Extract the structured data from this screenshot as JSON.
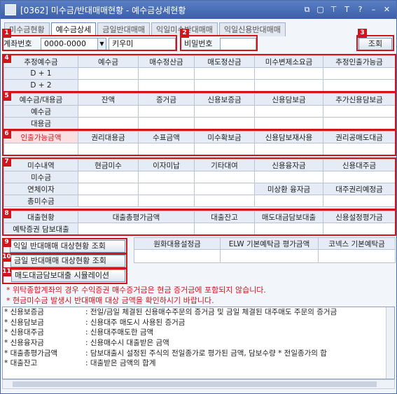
{
  "window": {
    "title": "[0362] 미수금/반대매매현황 - 예수금상세현황"
  },
  "tabs": [
    "미수금현황",
    "예수금상세",
    "금일반대매매",
    "익일미수반대매매",
    "익일신용반대매매"
  ],
  "toolbar": {
    "account_label": "계좌번호",
    "account_value": "0000-0000",
    "name_value": "키우미",
    "password_label": "비밀번호",
    "password_value": "",
    "query_button": "조회"
  },
  "badges": [
    "1",
    "2",
    "3",
    "4",
    "5",
    "6",
    "7",
    "8",
    "9",
    "10",
    "11"
  ],
  "grid4": {
    "headers": [
      "추정예수금",
      "예수금",
      "매수정산금",
      "매도정산금",
      "미수변제소요금",
      "추정인출가능금"
    ],
    "rows": [
      "D + 1",
      "D + 2"
    ]
  },
  "grid5": {
    "headers": [
      "예수금/대용금",
      "잔액",
      "증거금",
      "신용보증금",
      "신용담보금",
      "추가신용담보금"
    ],
    "rows": [
      "예수금",
      "대용금"
    ]
  },
  "grid6": {
    "headers": [
      "인출가능금액",
      "권리대용금",
      "수표금액",
      "미수확보금",
      "신용담보재사용",
      "권리공매도대금"
    ]
  },
  "grid7": {
    "headers": [
      "미수내역",
      "현금미수",
      "이자미납",
      "기타대여",
      "신용융자금",
      "신용대주금"
    ],
    "rows": [
      "미수금",
      "연체이자",
      "총미수금"
    ],
    "sub_headers": [
      "미상환 융자금",
      "대주권리예정금"
    ]
  },
  "grid8": {
    "headers": [
      "대출현황",
      "대출총평가금액",
      "대출잔고",
      "매도대금담보대출",
      "신용설정평가금"
    ],
    "row": "예탁증권 담보대출"
  },
  "side_buttons": [
    "익일 반대매매 대상현황 조회",
    "금일 반대매매 대상현황 조회",
    "매도대금담보대출 시뮬레이션"
  ],
  "grid_right": {
    "headers": [
      "원화대용설정금",
      "ELW 기본예탁금 평가금액",
      "코넥스 기본예탁금"
    ]
  },
  "notes": [
    "* 위탁종합계좌의 경우 수익증권 매수증거금은 현금 증거금에 포함되지 않습니다.",
    "* 현금미수금 발생시 반대매매 대상 금액을 확인하시기 바랍니다."
  ],
  "legend": [
    {
      "key": "* 신용보증금",
      "val": ": 전일/금일 체결된 신용매수주문의 증거금 및 금일 체결된 대주매도 주문의 증거금"
    },
    {
      "key": "* 신용담보금",
      "val": ": 신용대주 매도시 사용된 증거금"
    },
    {
      "key": "* 신용대주금",
      "val": ": 신용대주매도한 금액"
    },
    {
      "key": "* 신용융자금",
      "val": ": 신용매수시 대출받은 금액"
    },
    {
      "key": "* 대출총평가금액",
      "val": ": 담보대출시 설정된 주식의 전일종가로 평가된 금액, 담보수량 * 전일종가의 합"
    },
    {
      "key": "* 대출잔고",
      "val": ": 대출받은 금액의 합계"
    }
  ],
  "colors": {
    "accent": "#d0161c",
    "header": "#e6ecf6",
    "title": "#3b5fa8"
  }
}
